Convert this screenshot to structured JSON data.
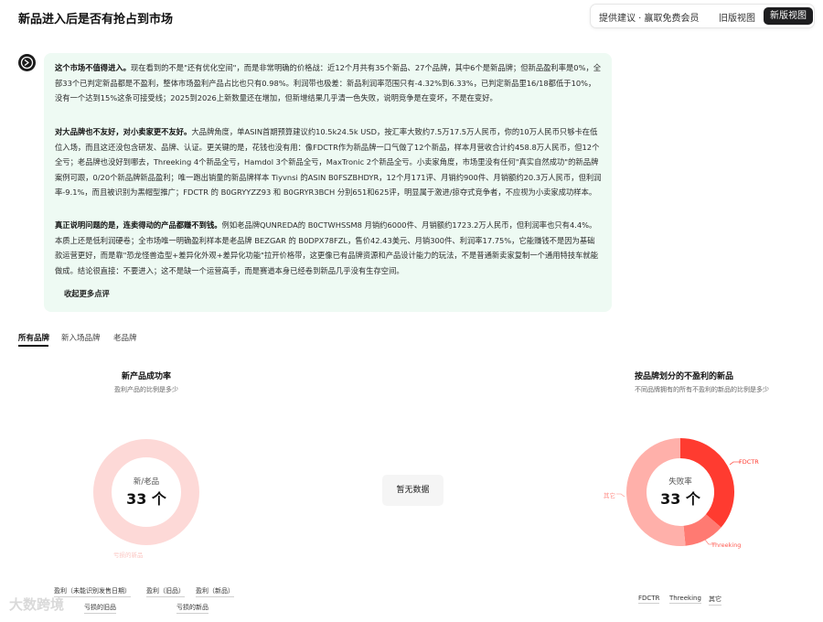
{
  "header": {
    "title": "新品进入后是否有抢占到市场",
    "feedback_label": "提供建议 · 赢取免费会员",
    "old_view_label": "旧版视图",
    "new_view_label": "新版视图"
  },
  "comment": {
    "p1_bold": "这个市场不值得进入。",
    "p1_text": "现在看到的不是\"还有优化空间\"，而是非常明确的价格战：近12个月共有35个新品、27个品牌，其中6个是新品牌；但新品盈利率是0%，全部33个已判定新品都是不盈利，整体市场盈利产品占比也只有0.98%。利润带也极差：新品利润率范围只有-4.32%到6.33%，已判定新品里16/18都低于10%，没有一个达到15%这条可接受线；2025到2026上新数量还在增加，但新增结果几乎清一色失败，说明竞争是在变坏，不是在变好。",
    "p2_bold": "对大品牌也不友好，对小卖家更不友好。",
    "p2_text": "大品牌角度，单ASIN首期预算建议约10.5k24.5k USD，按汇率大致约7.5万17.5万人民币，你的10万人民币只够卡在低位入场，而且这还没包含研发、品牌、认证。更关键的是，花钱也没有用：像FDCTR作为新品牌一口气做了12个新品，样本月营收合计约458.8万人民币，但12个全亏；老品牌也没好到哪去，Threeking 4个新品全亏，Hamdol 3个新品全亏，MaxTronic 2个新品全亏。小卖家角度，市场里没有任何\"真实自然成功\"的新品牌案例可跟，0/20个新品牌新品盈利；唯一跑出销量的新品牌样本 Tiyvnsi 的ASIN B0FSZBHDYR，12个月171评、月销约900件、月销额约20.3万人民币，但利润率-9.1%，而且被识别为黑帽型推广；FDCTR 的 B0GRYYZZ93 和 B0GRYR3BCH 分别651和625评，明显属于激进/掠夺式竞争者，不应视为小卖家成功样本。",
    "p3_bold": "真正说明问题的是，连卖得动的产品都赚不到钱。",
    "p3_text": "例如老品牌QUNREDA的 B0CTWHSSM8 月销约6000件、月销额约1723.2万人民币，但利润率也只有4.4%。本质上还是低利润硬卷；全市场唯一明确盈利样本是老品牌 BEZGAR 的 B0DPX78FZL，售价42.43美元、月销300件、利润率17.75%，它能赚钱不是因为基础款运营更好，而是靠\"恐龙怪兽造型+差异化外观+差异化功能\"拉开价格带，这更像已有品牌资源和产品设计能力的玩法，不是普通新卖家复制一个通用特技车就能做成。结论很直接：不要进入；这不是缺一个运营高手，而是赛道本身已经卷到新品几乎没有生存空间。",
    "collapse_label": "收起更多点评"
  },
  "tabs": [
    "所有品牌",
    "新入场品牌",
    "老品牌"
  ],
  "left_panel": {
    "title": "新产品成功率",
    "subtitle": "盈利产品的比例是多少",
    "center_label": "新/老品",
    "center_value": "33 个",
    "faint_label": "亏损的新品",
    "ring_color": "#fdd9d7",
    "legend": [
      "盈利（未能识别发售日期）",
      "盈利（旧品）",
      "盈利（新品）",
      "亏损的旧品",
      "亏损的新品"
    ]
  },
  "middle_panel": {
    "empty_label": "暂无数据"
  },
  "right_panel": {
    "title": "按品牌划分的不盈利的新品",
    "subtitle": "不同品牌拥有的所有不盈利的新品的比例是多少",
    "center_label": "失败率",
    "center_value": "33 个",
    "legend": [
      "FDCTR",
      "Threeking",
      "其它"
    ]
  },
  "chart_data": {
    "type": "pie",
    "categories": [
      "FDCTR",
      "Threeking",
      "其它"
    ],
    "values": [
      12,
      4,
      17
    ],
    "colors": [
      "#ff3b30",
      "#ff7a72",
      "#ffb0aa"
    ]
  },
  "watermark": "大数跨境"
}
